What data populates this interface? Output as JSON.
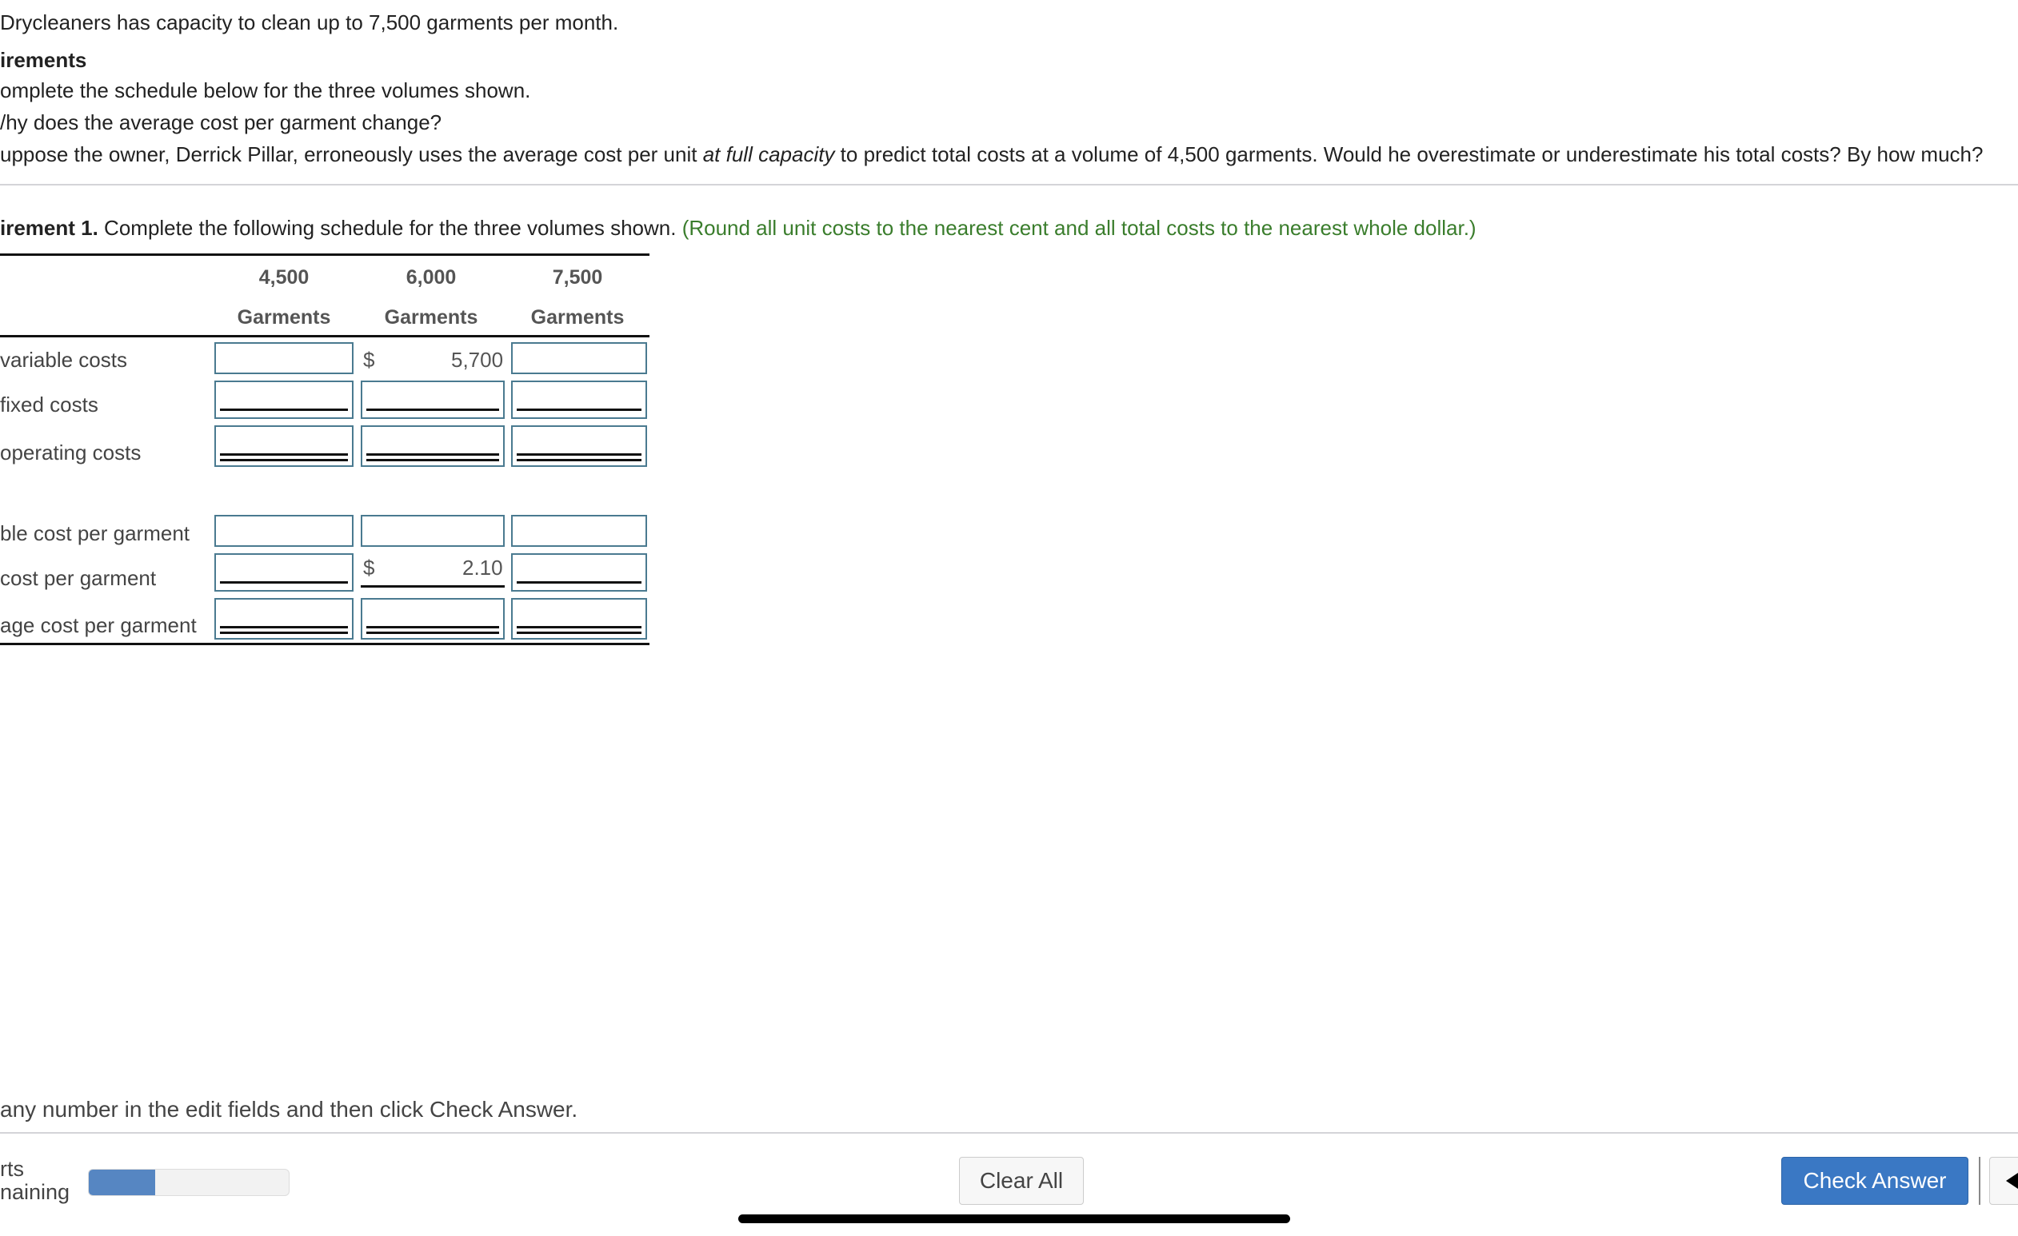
{
  "intro": {
    "capacity_text": "Drycleaners has capacity to clean up to 7,500 garments per month.",
    "requirements_heading": "irements",
    "requirements": [
      "omplete the schedule below for the three volumes shown.",
      "/hy does the average cost per garment change?"
    ],
    "req3_before": "uppose the owner, Derrick Pillar, erroneously uses the average cost per unit ",
    "req3_italic": "at full capacity",
    "req3_after": " to predict total costs at a volume of 4,500 garments. Would he overestimate or underestimate his total costs? By how much?"
  },
  "question": {
    "label": "irement 1.",
    "text": " Complete the following schedule for the three volumes shown.",
    "hint": "(Round all unit costs to the nearest cent and all total costs to the nearest whole dollar.)",
    "hint_color": "#3a7d2c"
  },
  "schedule": {
    "columns": [
      {
        "volume": "4,500",
        "unit": "Garments"
      },
      {
        "volume": "6,000",
        "unit": "Garments"
      },
      {
        "volume": "7,500",
        "unit": "Garments"
      }
    ],
    "rows": [
      {
        "label": "variable costs",
        "cells": [
          "",
          "$ 5,700",
          ""
        ]
      },
      {
        "label": "fixed costs",
        "cells": [
          "",
          "",
          ""
        ]
      },
      {
        "label": "operating costs",
        "cells": [
          "",
          "",
          ""
        ]
      },
      {
        "label": "ble cost per garment",
        "cells": [
          "",
          "",
          ""
        ]
      },
      {
        "label": " cost per garment",
        "cells": [
          "",
          "$ 2.10",
          ""
        ]
      },
      {
        "label": "age cost per garment",
        "cells": [
          "",
          "",
          ""
        ]
      }
    ],
    "given": {
      "variable_6000_symbol": "$",
      "variable_6000_value": "5,700",
      "fixed_per_unit_6000_symbol": "$",
      "fixed_per_unit_6000_value": "2.10"
    }
  },
  "footer": {
    "instruction": "any number in the edit fields and then click Check Answer.",
    "parts_label_1": "rts",
    "parts_label_2": "naining",
    "progress_fraction": 0.33,
    "progress_color": "#5686c2",
    "clear_all": "Clear All",
    "check_answer": "Check Answer",
    "check_answer_color": "#3a78c4"
  }
}
